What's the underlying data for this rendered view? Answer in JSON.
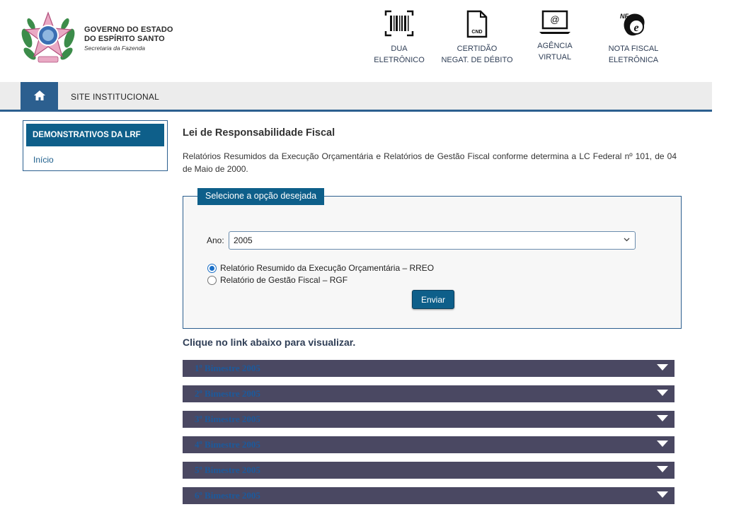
{
  "header": {
    "brand_line1": "GOVERNO DO ESTADO",
    "brand_line2": "DO ESPÍRITO SANTO",
    "brand_line3": "Secretaria da Fazenda",
    "services": [
      {
        "line1": "DUA",
        "line2": "ELETRÔNICO",
        "icon": "barcode-icon"
      },
      {
        "line1": "CERTIDÃO",
        "line2": "NEGAT. DE DÉBITO",
        "icon": "cnd-document-icon",
        "icon_text": "CND"
      },
      {
        "line1": "AGÊNCIA",
        "line2": "VIRTUAL",
        "icon": "laptop-at-icon",
        "icon_text": "@"
      },
      {
        "line1": "NOTA FISCAL",
        "line2": "ELETRÔNICA",
        "icon": "nfe-icon",
        "icon_text": "NF"
      }
    ]
  },
  "nav": {
    "home_icon": "home-icon",
    "site_link": "SITE INSTITUCIONAL"
  },
  "sidebar": {
    "heading": "DEMONSTRATIVOS DA LRF",
    "items": [
      {
        "label": "Início"
      }
    ]
  },
  "main": {
    "title": "Lei de Responsabilidade Fiscal",
    "description": "Relatórios Resumidos da Execução Orçamentária e Relatórios de Gestão Fiscal conforme determina a LC Federal nº 101, de 04 de Maio de 2000.",
    "form": {
      "legend": "Selecione a opção desejada",
      "ano_label": "Ano:",
      "ano_value": "2005",
      "options": [
        {
          "label": "Relatório Resumido da Execução Orçamentária – RREO",
          "selected": true
        },
        {
          "label": "Relatório de Gestão Fiscal – RGF",
          "selected": false
        }
      ],
      "submit_label": "Enviar"
    },
    "clique": "Clique no link abaixo para visualizar.",
    "bimestres": [
      {
        "label": "1º Bimestre 2005"
      },
      {
        "label": "2º Bimestre 2005"
      },
      {
        "label": "3º Bimestre 2005"
      },
      {
        "label": "4º Bimestre 2005"
      },
      {
        "label": "5º Bimestre 2005"
      },
      {
        "label": "6º Bimestre 2005"
      }
    ]
  },
  "colors": {
    "primary": "#0e5f8a",
    "nav_blue": "#2c5f8f",
    "accordion": "#4a4862",
    "accordion_text": "#1c5a9c"
  }
}
